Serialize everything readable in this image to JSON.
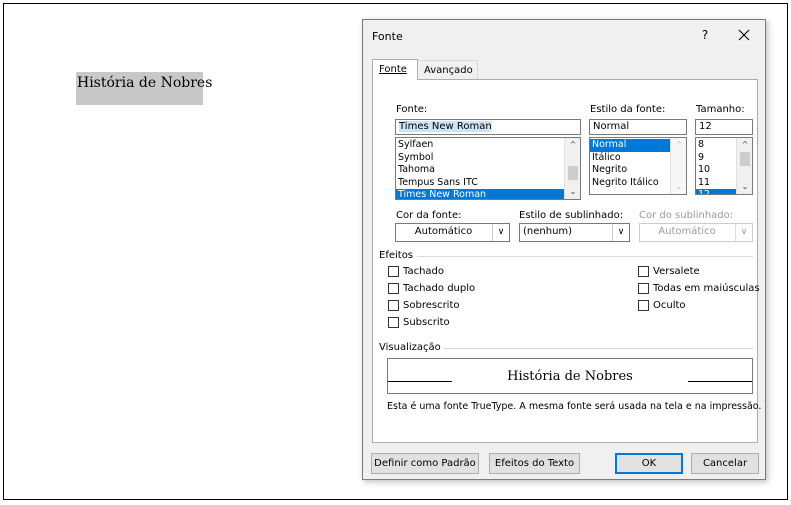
{
  "document": {
    "selected_text": "História de Nobres"
  },
  "dialog": {
    "title": "Fonte",
    "help_label": "?",
    "tabs": [
      {
        "label": "Fonte",
        "active": true
      },
      {
        "label": "Avançado",
        "active": false
      }
    ],
    "font": {
      "label": "Fonte:",
      "value": "Times New Roman",
      "list": [
        "Sylfaen",
        "Symbol",
        "Tahoma",
        "Tempus Sans ITC",
        "Times New Roman"
      ],
      "selected": "Times New Roman"
    },
    "style": {
      "label": "Estilo da fonte:",
      "value": "Normal",
      "list": [
        "Normal",
        "Itálico",
        "Negrito",
        "Negrito Itálico"
      ],
      "selected": "Normal"
    },
    "size": {
      "label": "Tamanho:",
      "value": "12",
      "list": [
        "8",
        "9",
        "10",
        "11",
        "12"
      ],
      "selected": "12"
    },
    "font_color": {
      "label": "Cor da fonte:",
      "value": "Automático"
    },
    "underline_style": {
      "label": "Estilo de sublinhado:",
      "value": "(nenhum)"
    },
    "underline_color": {
      "label": "Cor do sublinhado:",
      "value": "Automático",
      "disabled": true
    },
    "effects": {
      "header": "Efeitos",
      "left": [
        {
          "label": "Tachado",
          "checked": false
        },
        {
          "label": "Tachado duplo",
          "checked": false
        },
        {
          "label": "Sobrescrito",
          "checked": false
        },
        {
          "label": "Subscrito",
          "checked": false
        }
      ],
      "right": [
        {
          "label": "Versalete",
          "checked": false
        },
        {
          "label": "Todas em maiúsculas",
          "checked": false
        },
        {
          "label": "Oculto",
          "checked": false
        }
      ]
    },
    "preview": {
      "header": "Visualização",
      "sample": "História de Nobres",
      "note": "Esta é uma fonte TrueType. A mesma fonte será usada na tela e na impressão."
    },
    "buttons": {
      "set_default": "Definir como Padrão",
      "text_effects": "Efeitos do Texto",
      "ok": "OK",
      "cancel": "Cancelar"
    }
  },
  "colors": {
    "selection": "#0078d7",
    "dialog_bg": "#f0f0f0",
    "doc_highlight": "#c8c8c8"
  }
}
